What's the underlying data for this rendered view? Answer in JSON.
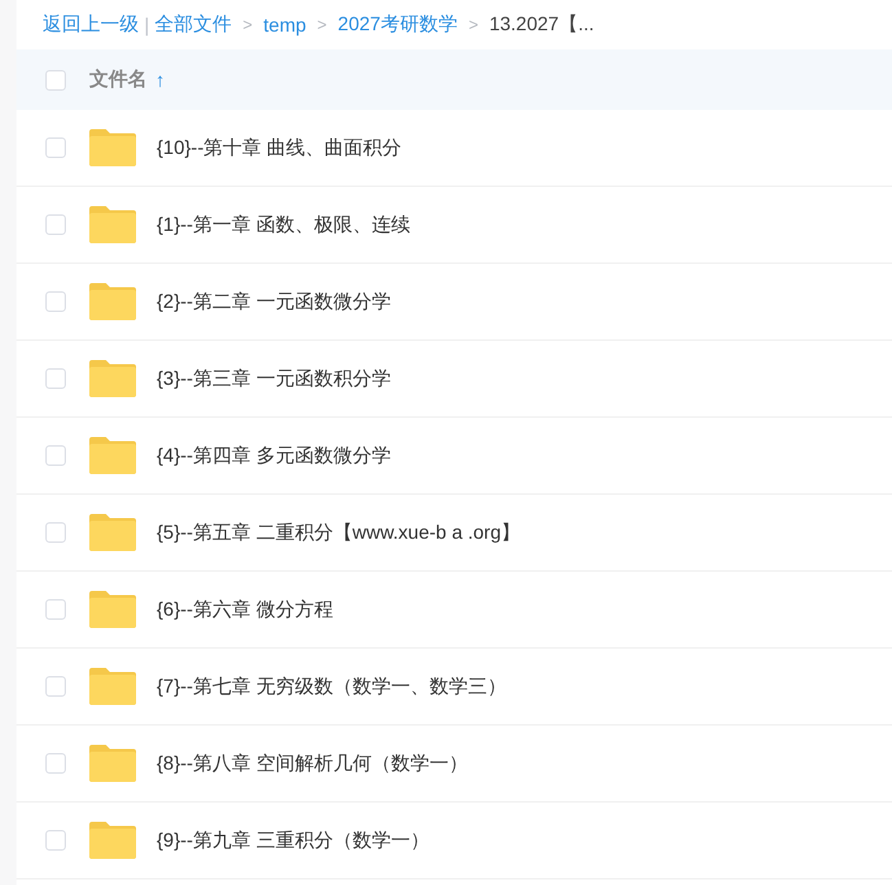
{
  "breadcrumb": {
    "back": "返回上一级",
    "separator": "|",
    "items": [
      {
        "label": "全部文件",
        "current": false
      },
      {
        "label": "temp",
        "current": false
      },
      {
        "label": "2027考研数学",
        "current": false
      },
      {
        "label": "13.2027【...",
        "current": true
      }
    ],
    "arrow": ">"
  },
  "table": {
    "header": {
      "label": "文件名",
      "checked": false,
      "ascending": true,
      "sort_glyph": "↑"
    },
    "rows": [
      {
        "name": "{10}--第十章 曲线、曲面积分",
        "checked": false
      },
      {
        "name": "{1}--第一章 函数、极限、连续",
        "checked": false
      },
      {
        "name": "{2}--第二章 一元函数微分学",
        "checked": false
      },
      {
        "name": "{3}--第三章 一元函数积分学",
        "checked": false
      },
      {
        "name": "{4}--第四章 多元函数微分学",
        "checked": false
      },
      {
        "name": "{5}--第五章 二重积分【www.xue-b a .org】",
        "checked": false
      },
      {
        "name": "{6}--第六章 微分方程",
        "checked": false
      },
      {
        "name": "{7}--第七章 无穷级数（数学一、数学三）",
        "checked": false
      },
      {
        "name": "{8}--第八章 空间解析几何（数学一）",
        "checked": false
      },
      {
        "name": "{9}--第九章 三重积分（数学一）",
        "checked": false
      }
    ]
  }
}
